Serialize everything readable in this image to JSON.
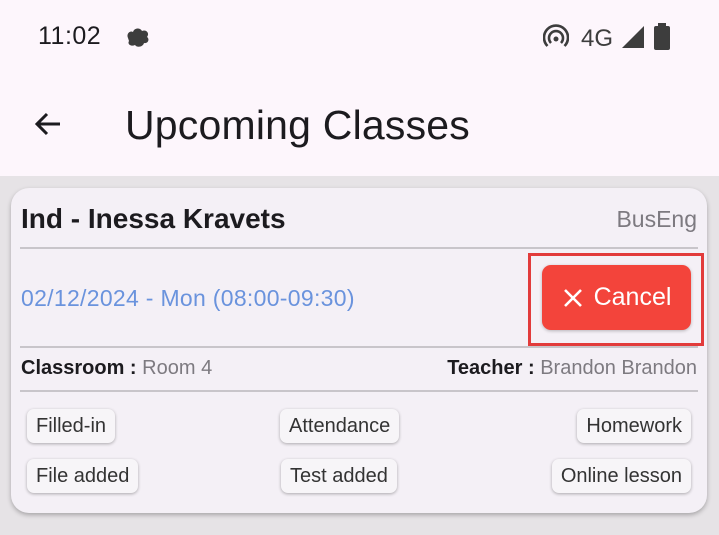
{
  "status_bar": {
    "time": "11:02",
    "network": "4G",
    "icons": [
      "notification-creature-icon",
      "hotspot-icon",
      "signal-icon",
      "battery-icon"
    ]
  },
  "app_bar": {
    "back_icon": "arrow-left-icon",
    "title": "Upcoming Classes"
  },
  "class_card": {
    "title": "Ind - Inessa Kravets",
    "subject": "BusEng",
    "date_time": "02/12/2024 - Mon (08:00-09:30)",
    "cancel_label": "Cancel",
    "cancel_icon": "close-icon",
    "classroom_label": "Classroom : ",
    "classroom_value": "Room 4",
    "teacher_label": "Teacher : ",
    "teacher_value": "Brandon Brandon",
    "tags": [
      "Filled-in",
      "Attendance",
      "Homework",
      "File added",
      "Test added",
      "Online lesson"
    ]
  },
  "colors": {
    "accent_blue": "#6a93dd",
    "cancel_red": "#f3443b",
    "highlight_red": "#e23b3b",
    "background": "#fdf6fc",
    "card": "#f4f0f6"
  }
}
